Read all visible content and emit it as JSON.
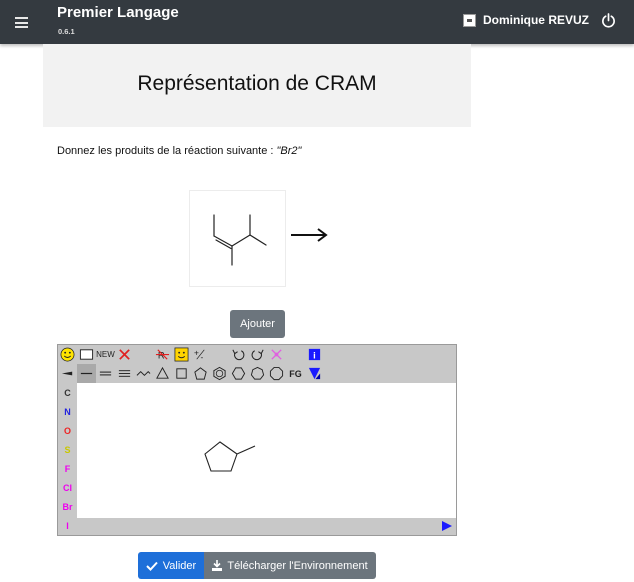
{
  "header": {
    "app_title": "Premier Langage",
    "version": "0.6.1",
    "user_name": "Dominique REVUZ"
  },
  "exercise": {
    "title": "Représentation de CRAM",
    "question_prefix": "Donnez les produits de la réaction suivante : ",
    "reagent": "\"Br2\""
  },
  "buttons": {
    "add_label": "Ajouter",
    "validate_label": "Valider",
    "download_label": "Télécharger l'Environnement"
  },
  "editor": {
    "new_label": "NEW",
    "fg_label": "FG",
    "atoms": [
      {
        "symbol": "C",
        "color": "#333333"
      },
      {
        "symbol": "N",
        "color": "#2222dd"
      },
      {
        "symbol": "O",
        "color": "#ee2222"
      },
      {
        "symbol": "S",
        "color": "#c8c800"
      },
      {
        "symbol": "F",
        "color": "#ee00ee"
      },
      {
        "symbol": "Cl",
        "color": "#ee00ee"
      },
      {
        "symbol": "Br",
        "color": "#ee00ee"
      },
      {
        "symbol": "I",
        "color": "#ee00ee"
      }
    ]
  },
  "colors": {
    "topbar": "#343a40",
    "primary": "#1e6fd9",
    "secondary": "#6c757d"
  }
}
